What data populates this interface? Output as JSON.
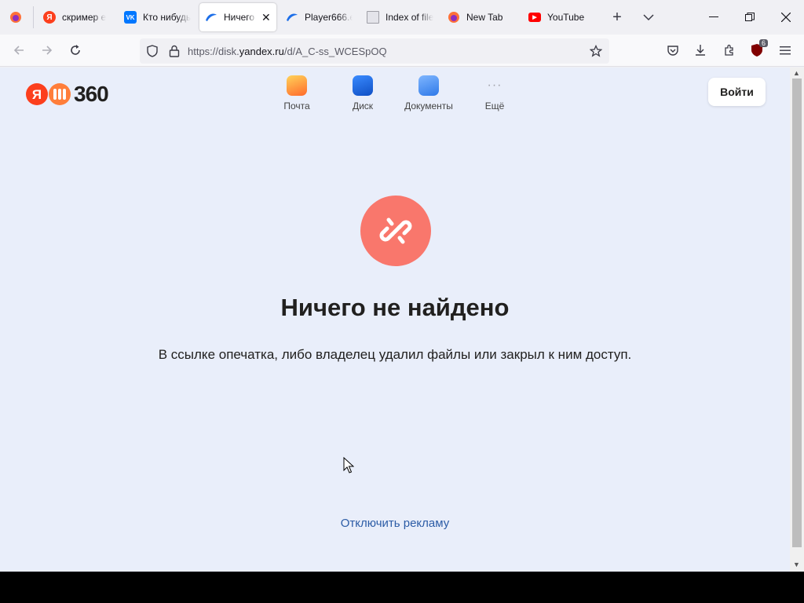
{
  "tabs": [
    {
      "title": "скример е",
      "favicon": "yandex-icon",
      "color": "#fc3f1d",
      "glyph": "Я"
    },
    {
      "title": "Кто нибудь",
      "favicon": "vk-icon",
      "color": "#0077ff",
      "glyph": "VK"
    },
    {
      "title": "Ничего",
      "favicon": "yandex-disk-icon",
      "color": "#1c6ee8",
      "glyph": ""
    },
    {
      "title": "Player666.e",
      "favicon": "yandex-disk-icon",
      "color": "#1c6ee8",
      "glyph": ""
    },
    {
      "title": "Index of file",
      "favicon": "file-icon",
      "color": "#9e9ea6",
      "glyph": ""
    },
    {
      "title": "New Tab",
      "favicon": "firefox-icon",
      "color": "#e25920",
      "glyph": ""
    },
    {
      "title": "YouTube",
      "favicon": "youtube-icon",
      "color": "#ff0000",
      "glyph": "▶"
    }
  ],
  "active_tab": 2,
  "toolbar": {
    "url_prefix": "https://disk.",
    "url_domain": "yandex.ru",
    "url_path": "/d/A_C-ss_WCESpOQ",
    "extension_badge": "6"
  },
  "header": {
    "logo_text": "360",
    "services": [
      {
        "label": "Почта",
        "icon": "mail-icon",
        "color": "#ff9a2e"
      },
      {
        "label": "Диск",
        "icon": "disk-icon",
        "color": "#1f6fe0"
      },
      {
        "label": "Документы",
        "icon": "documents-icon",
        "color": "#3a8ee6"
      },
      {
        "label": "Ещё",
        "icon": "more-icon",
        "color": "#a0a0a8"
      }
    ],
    "login_label": "Войти"
  },
  "main": {
    "title": "Ничего не найдено",
    "description": "В ссылке опечатка, либо владелец удалил файлы или закрыл к ним доступ.",
    "disable_ads": "Отключить рекламу",
    "icon_color": "#f9776c"
  }
}
